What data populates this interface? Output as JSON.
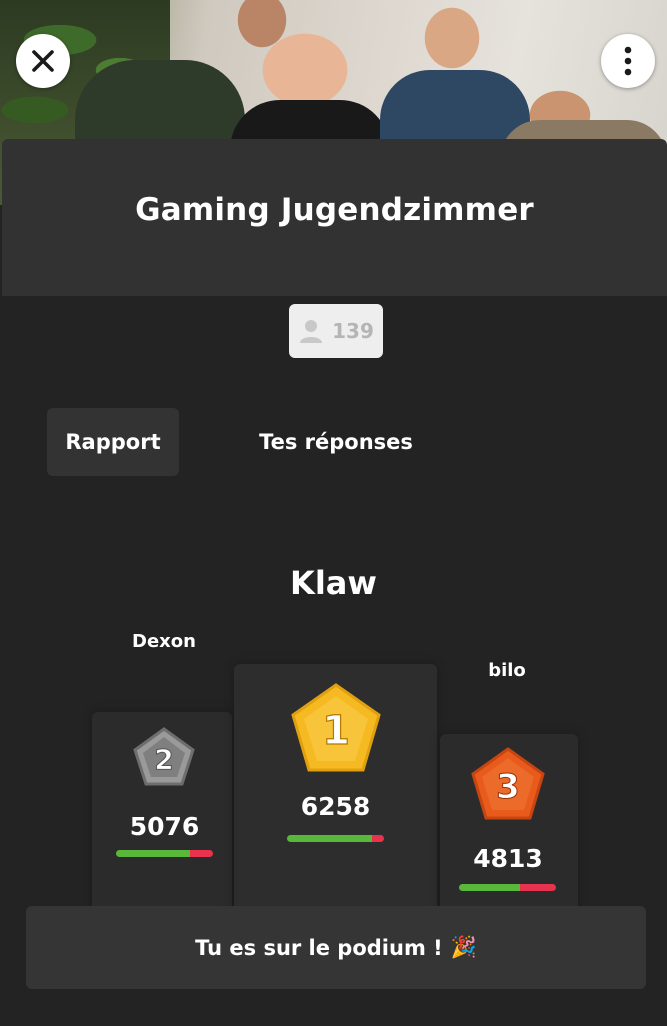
{
  "header": {
    "close_icon": "close-icon",
    "more_icon": "more-vertical-icon"
  },
  "quiz": {
    "title": "Gaming Jugendzimmer",
    "participants_icon": "user-icon",
    "participants_count": "139"
  },
  "tabs": [
    {
      "label": "Rapport",
      "active": true
    },
    {
      "label": "Tes réponses",
      "active": false
    }
  ],
  "podium": {
    "first": {
      "rank": "1",
      "name": "Klaw",
      "score": "6258",
      "correct_fraction": 0.88,
      "color": "#f5b921"
    },
    "second": {
      "rank": "2",
      "name": "Dexon",
      "score": "5076",
      "correct_fraction": 0.76,
      "color": "#8a8a8a"
    },
    "third": {
      "rank": "3",
      "name": "bilo",
      "score": "4813",
      "correct_fraction": 0.63,
      "color": "#e85b1c"
    }
  },
  "toast": {
    "message": "Tu es sur le podium !",
    "emoji": "🎉"
  },
  "colors": {
    "background": "#232323",
    "correct": "#59b83a",
    "wrong": "#e8334f"
  }
}
